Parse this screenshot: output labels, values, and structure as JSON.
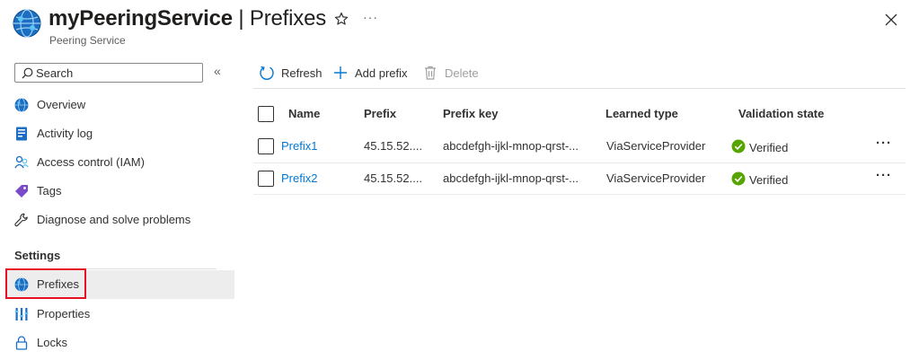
{
  "header": {
    "title": "myPeeringService",
    "separator": "|",
    "blade": "Prefixes",
    "subtitle": "Peering Service"
  },
  "search": {
    "placeholder": "Search"
  },
  "sidebar": {
    "items": [
      {
        "label": "Overview",
        "icon": "globe-icon"
      },
      {
        "label": "Activity log",
        "icon": "activity-log-icon"
      },
      {
        "label": "Access control (IAM)",
        "icon": "people-icon"
      },
      {
        "label": "Tags",
        "icon": "tag-icon"
      },
      {
        "label": "Diagnose and solve problems",
        "icon": "wrench-icon"
      }
    ],
    "section_heading": "Settings",
    "settings_items": [
      {
        "label": "Prefixes",
        "icon": "globe-icon",
        "selected": true
      },
      {
        "label": "Properties",
        "icon": "properties-icon"
      },
      {
        "label": "Locks",
        "icon": "lock-icon"
      }
    ]
  },
  "toolbar": {
    "refresh": "Refresh",
    "add_prefix": "Add prefix",
    "delete": "Delete"
  },
  "table": {
    "columns": [
      "Name",
      "Prefix",
      "Prefix key",
      "Learned type",
      "Validation state"
    ],
    "rows": [
      {
        "name": "Prefix1",
        "prefix": "45.15.52....",
        "prefix_key": "abcdefgh-ijkl-mnop-qrst-...",
        "learned_type": "ViaServiceProvider",
        "validation_state": "Verified"
      },
      {
        "name": "Prefix2",
        "prefix": "45.15.52....",
        "prefix_key": "abcdefgh-ijkl-mnop-qrst-...",
        "learned_type": "ViaServiceProvider",
        "validation_state": "Verified"
      }
    ]
  },
  "colors": {
    "accent": "#0078d4",
    "selected_outline": "#e81123",
    "verified": "#57a300",
    "selected_bg": "#ededed"
  }
}
